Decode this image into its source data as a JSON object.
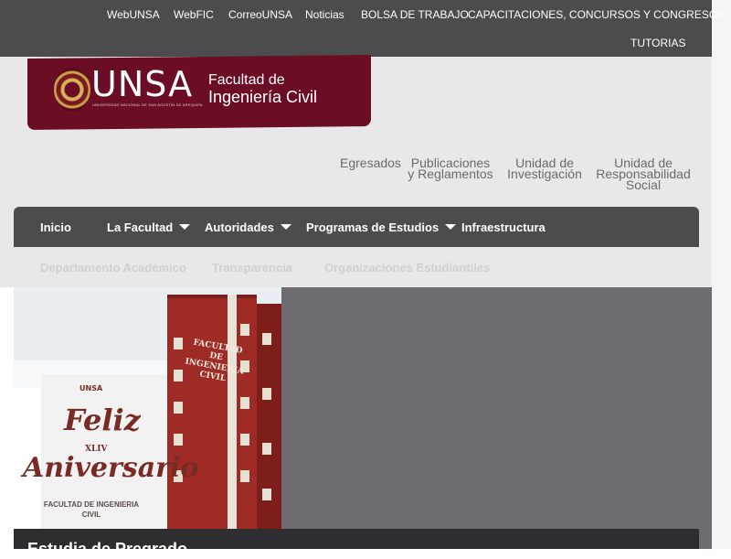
{
  "topbar": {
    "links": [
      "WebUNSA",
      "WebFIC",
      "CorreoUNSA",
      "Noticias",
      "BOLSA DE TRABAJO",
      "CAPACITACIONES, CONCURSOS Y CONGRESOS",
      "TUTORIAS"
    ]
  },
  "logo": {
    "unsa": "UNSA",
    "subtitle": "UNIVERSIDAD NACIONAL DE SAN AGUSTÍN DE AREQUIPA",
    "faculty_line1": "Facultad de",
    "faculty_line2": "Ingeniería Civil"
  },
  "secondary_nav": [
    {
      "line1": "Egresados",
      "line2": "",
      "line3": ""
    },
    {
      "line1": "Publicaciones",
      "line2": "y Reglamentos",
      "line3": ""
    },
    {
      "line1": "Unidad de",
      "line2": "Investigación",
      "line3": ""
    },
    {
      "line1": "Unidad de",
      "line2": "Responsabilidad",
      "line3": "Social"
    }
  ],
  "main_nav": [
    "Inicio",
    "La Facultad",
    "Autoridades",
    "Programas de Estudios",
    "Infraestructura"
  ],
  "sub_nav": [
    "Departamento Académico",
    "Transparencia",
    "Organizaciones Estudiantiles"
  ],
  "banner": {
    "unsa": "UNSA",
    "feliz": "Feliz",
    "number": "XLIV",
    "aniversario": "Aniversario",
    "faculty_line1": "FACULTAD DE INGENIERIA",
    "faculty_line2": "CIVIL",
    "sign_line1": "FACULTAD",
    "sign_line2": "DE",
    "sign_line3": "INGENIERIA",
    "sign_line4": "CIVIL"
  },
  "caption": "Estudia de Pregrado",
  "colors": {
    "topbar": "#4c4b4d",
    "brand": "#6b0d24",
    "header_bg": "#e8e8e8"
  }
}
